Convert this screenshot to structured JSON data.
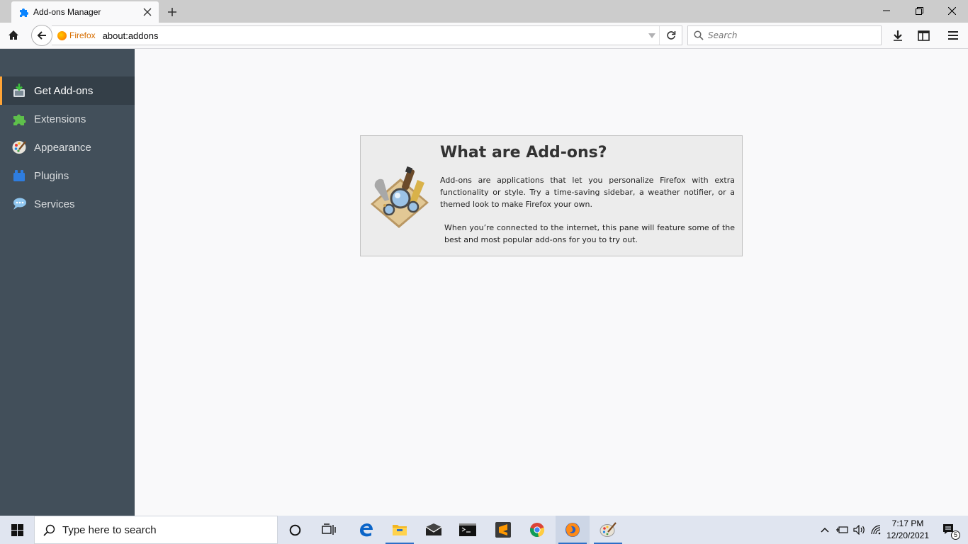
{
  "tab": {
    "title": "Add-ons Manager"
  },
  "navbar": {
    "identity_label": "Firefox",
    "url": "about:addons",
    "search_placeholder": "Search"
  },
  "sidebar": {
    "items": [
      {
        "label": "Get Add-ons",
        "icon": "get-addons-icon",
        "selected": true
      },
      {
        "label": "Extensions",
        "icon": "puzzle-icon",
        "selected": false
      },
      {
        "label": "Appearance",
        "icon": "palette-icon",
        "selected": false
      },
      {
        "label": "Plugins",
        "icon": "lego-brick-icon",
        "selected": false
      },
      {
        "label": "Services",
        "icon": "speech-bubble-icon",
        "selected": false
      }
    ]
  },
  "discover": {
    "title": "What are Add-ons?",
    "paragraph1": "Add-ons are applications that let you personalize Firefox with extra functionality or style. Try a time-saving sidebar, a weather notifier, or a themed look to make Firefox your own.",
    "paragraph2": "When you’re connected to the internet, this pane will feature some of the best and most popular add-ons for you to try out."
  },
  "taskbar": {
    "search_placeholder": "Type here to search",
    "time": "7:17 PM",
    "date": "12/20/2021",
    "notification_count": "5"
  },
  "colors": {
    "sidebar_bg": "#424f5a",
    "sidebar_selected_bg": "#343f48",
    "selected_accent": "#ffa436",
    "taskbar_bg": "#e0e5f0"
  }
}
